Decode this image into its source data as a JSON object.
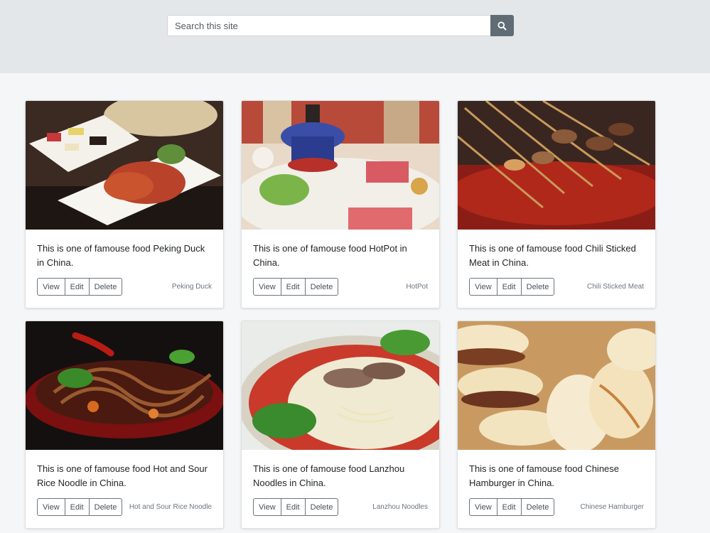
{
  "search": {
    "placeholder": "Search this site",
    "button_icon": "search-icon"
  },
  "cards": [
    {
      "desc": "This is one of famouse food Peking Duck in China.",
      "tag": "Peking Duck",
      "buttons": [
        "View",
        "Edit",
        "Delete"
      ]
    },
    {
      "desc": "This is one of famouse food HotPot in China.",
      "tag": "HotPot",
      "buttons": [
        "View",
        "Edit",
        "Delete"
      ]
    },
    {
      "desc": "This is one of famouse food Chili Sticked Meat in China.",
      "tag": "Chili Sticked Meat",
      "buttons": [
        "View",
        "Edit",
        "Delete"
      ]
    },
    {
      "desc": "This is one of famouse food Hot and Sour Rice Noodle in China.",
      "tag": "Hot and Sour Rice Noodle",
      "buttons": [
        "View",
        "Edit",
        "Delete"
      ]
    },
    {
      "desc": "This is one of famouse food Lanzhou Noodles in China.",
      "tag": "Lanzhou Noodles",
      "buttons": [
        "View",
        "Edit",
        "Delete"
      ]
    },
    {
      "desc": "This is one of famouse food Chinese Hamburger in China.",
      "tag": "Chinese Hamburger",
      "buttons": [
        "View",
        "Edit",
        "Delete"
      ]
    }
  ],
  "colors": {
    "header_bg": "#e4e7ea",
    "page_bg": "#f4f6f8",
    "search_button": "#5f6b75"
  }
}
